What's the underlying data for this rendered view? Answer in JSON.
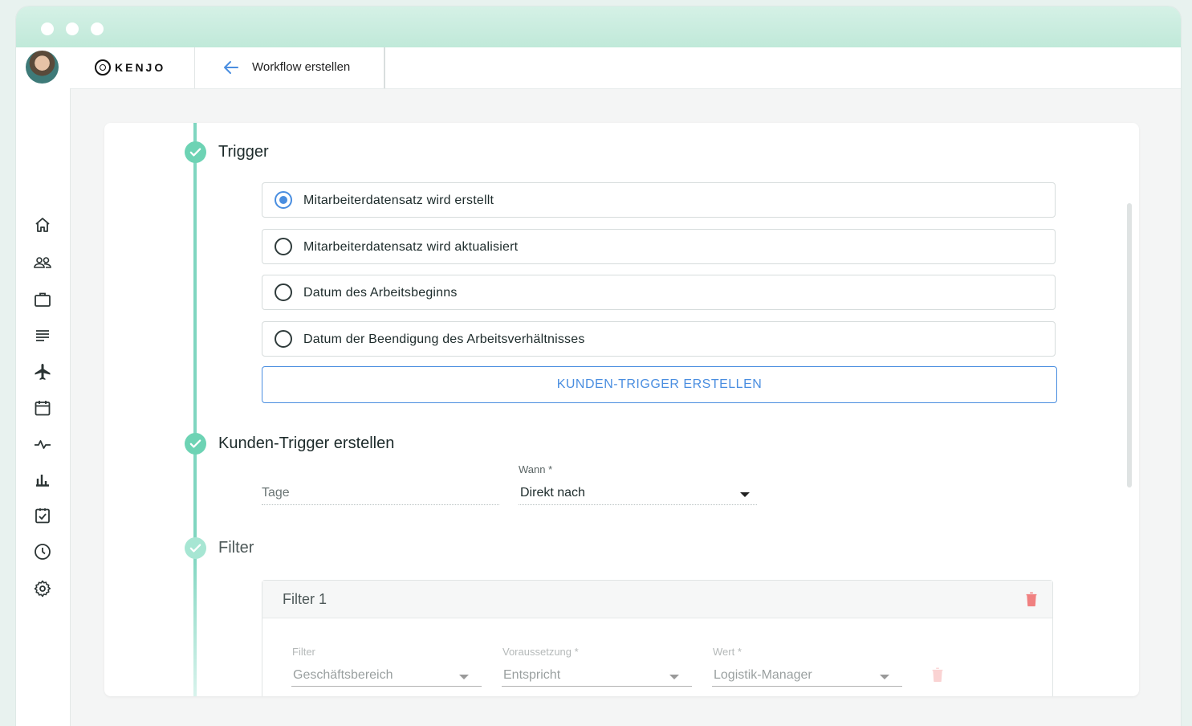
{
  "app": {
    "logo_text": "KENJO",
    "breadcrumb": "Workflow erstellen"
  },
  "sidebar": {
    "icons": [
      "home-icon",
      "people-icon",
      "briefcase-icon",
      "document-list-icon",
      "airplane-icon",
      "calendar-icon",
      "pulse-icon",
      "bar-chart-icon",
      "task-check-icon",
      "clock-icon",
      "settings-icon"
    ]
  },
  "steps": {
    "trigger": {
      "title": "Trigger",
      "options": [
        {
          "label": "Mitarbeiterdatensatz wird erstellt",
          "selected": true
        },
        {
          "label": "Mitarbeiterdatensatz wird aktualisiert",
          "selected": false
        },
        {
          "label": "Datum des Arbeitsbeginns",
          "selected": false
        },
        {
          "label": "Datum der Beendigung des Arbeitsverhältnisses",
          "selected": false
        }
      ],
      "custom_button": "KUNDEN-TRIGGER ERSTELLEN"
    },
    "custom_trigger": {
      "title": "Kunden-Trigger erstellen",
      "days_placeholder": "Tage",
      "when_label": "Wann *",
      "when_value": "Direkt nach"
    },
    "filter": {
      "title": "Filter",
      "box_title": "Filter 1",
      "filter_label": "Filter",
      "filter_value": "Geschäftsbereich",
      "condition_label": "Voraussetzung *",
      "condition_value": "Entspricht",
      "value_label": "Wert *",
      "value_value": "Logistik-Manager"
    }
  },
  "colors": {
    "accent": "#4a8ee0",
    "step_green": "#6dd3b4",
    "trash_red": "#f08080"
  }
}
